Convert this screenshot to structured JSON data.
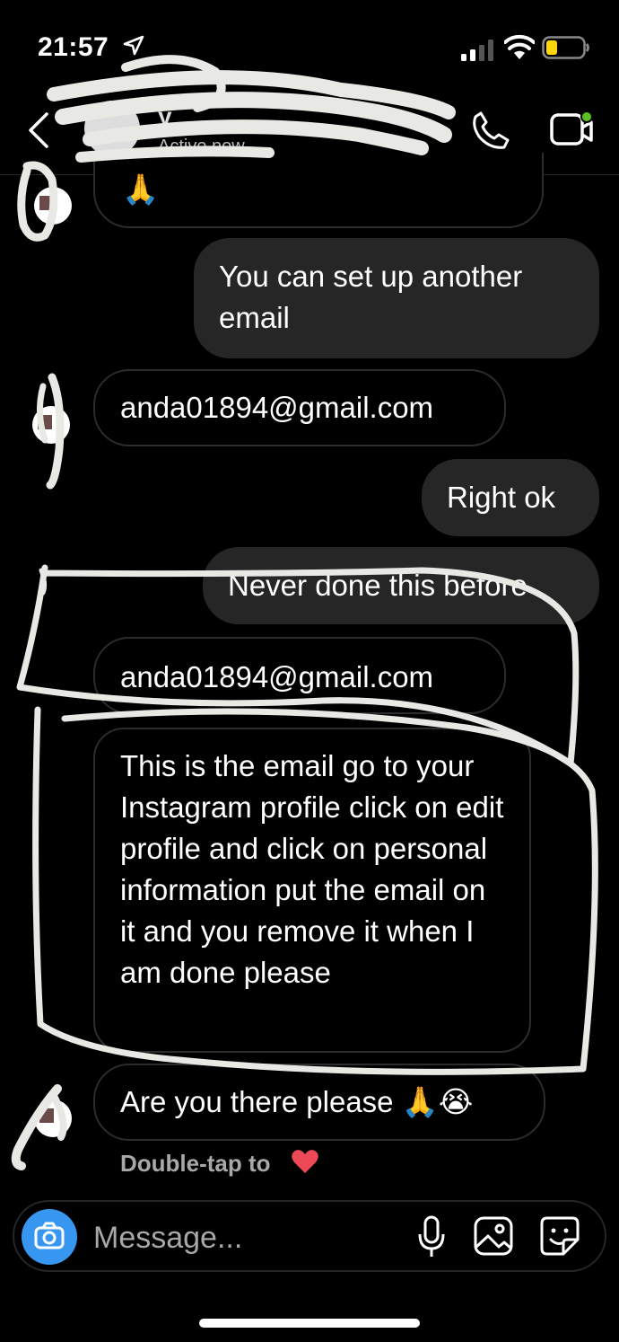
{
  "status_bar": {
    "time": "21:57",
    "location_icon": "location-arrow-icon",
    "signal_icon": "cellular-signal-icon",
    "wifi_icon": "wifi-icon",
    "battery_icon": "battery-low-icon",
    "battery_color": "#ffd60a"
  },
  "header": {
    "back_icon": "chevron-left-icon",
    "contact_name": "y",
    "contact_status": "Active now",
    "call_icon": "phone-icon",
    "video_icon": "video-camera-icon",
    "video_indicator_color": "#58c322"
  },
  "messages": [
    {
      "direction": "incoming",
      "text": "🙏"
    },
    {
      "direction": "outgoing",
      "text": "You can set up another email"
    },
    {
      "direction": "incoming",
      "text": "anda01894@gmail.com"
    },
    {
      "direction": "outgoing",
      "text": "Right ok"
    },
    {
      "direction": "outgoing",
      "text": "Never done this before"
    },
    {
      "direction": "incoming",
      "text": "anda01894@gmail.com"
    },
    {
      "direction": "incoming",
      "text": "This is the email go to your Instagram profile click on edit profile and click on personal information put the email on it and you remove it when I am done please"
    },
    {
      "direction": "incoming",
      "text": "Are you there please 🙏😭"
    }
  ],
  "hint": {
    "text": "Double-tap to",
    "heart_color": "#ed4956"
  },
  "composer": {
    "placeholder": "Message...",
    "camera_icon": "camera-icon",
    "mic_icon": "microphone-icon",
    "gallery_icon": "gallery-icon",
    "sticker_icon": "sticker-icon",
    "camera_color": "#3797f0"
  },
  "colors": {
    "background": "#000000",
    "outgoing_bubble": "#262626",
    "incoming_border": "#2c2c2c",
    "scribble": "#e8e8e4"
  }
}
